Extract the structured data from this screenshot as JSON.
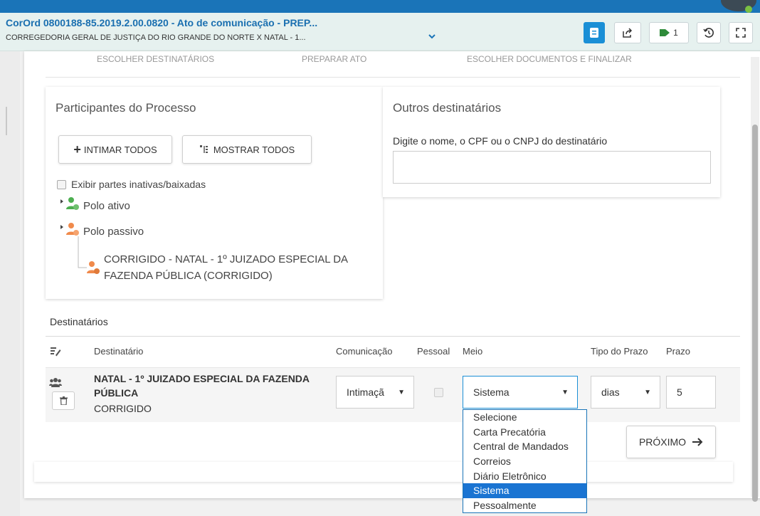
{
  "header": {
    "title": "CorOrd 0800188-85.2019.2.00.0820 - Ato de comunicação - PREP...",
    "subtitle": "CORREGEDORIA GERAL DE JUSTIÇA DO RIO GRANDE DO NORTE X NATAL - 1...",
    "tag_count": "1",
    "icons": [
      "document-icon",
      "share-icon",
      "tag-icon",
      "history-icon",
      "fullscreen-icon"
    ]
  },
  "steps": [
    "ESCOLHER DESTINATÁRIOS",
    "PREPARAR ATO",
    "ESCOLHER DOCUMENTOS E FINALIZAR"
  ],
  "participants": {
    "title": "Participantes do Processo",
    "intimar_all": "INTIMAR TODOS",
    "show_all": "MOSTRAR TODOS",
    "show_inactive": "Exibir partes inativas/baixadas",
    "active_pole": "Polo ativo",
    "passive_pole": "Polo passivo",
    "party_line1": "CORRIGIDO - NATAL - 1º JUIZADO ESPECIAL DA",
    "party_line2": "FAZENDA PÚBLICA (CORRIGIDO)"
  },
  "others": {
    "title": "Outros destinatários",
    "label": "Digite o nome, o CPF ou o CNPJ do destinatário",
    "value": ""
  },
  "recipients": {
    "title": "Destinatários",
    "columns": [
      "Destinatário",
      "Comunicação",
      "Pessoal",
      "Meio",
      "Tipo do Prazo",
      "Prazo"
    ],
    "row": {
      "name_line1": "NATAL - 1º JUIZADO ESPECIAL DA FAZENDA",
      "name_line2": "PÚBLICA",
      "role": "CORRIGIDO",
      "communication": "Intimaçã",
      "means": "Sistema",
      "deadline_type": "dias",
      "deadline": "5"
    }
  },
  "means_options": [
    "Selecione",
    "Carta Precatória",
    "Central de Mandados",
    "Correios",
    "Diário Eletrônico",
    "Sistema",
    "Pessoalmente"
  ],
  "next_label": "PRÓXIMO",
  "colors": {
    "primary": "#1a74b8",
    "active_pole": "#4caf50",
    "passive_pole": "#f08a4b",
    "selected_option": "#1a74d2"
  }
}
